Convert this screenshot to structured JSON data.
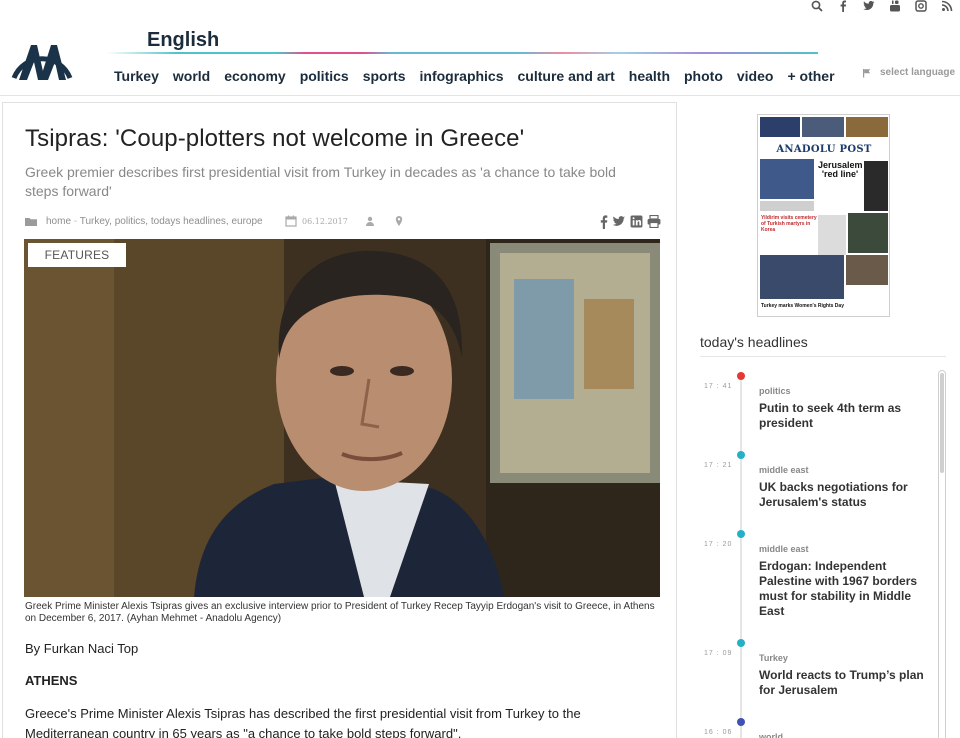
{
  "header": {
    "edition": "English",
    "nav": [
      "Turkey",
      "world",
      "economy",
      "politics",
      "sports",
      "infographics",
      "culture and art",
      "health",
      "photo",
      "video",
      "+ other"
    ],
    "select_language": "select language",
    "social_icons": [
      "search-icon",
      "facebook-icon",
      "twitter-icon",
      "youtube-icon",
      "instagram-icon",
      "rss-icon"
    ]
  },
  "article": {
    "title": "Tsipras: 'Coup-plotters not welcome in Greece'",
    "subtitle": "Greek premier describes first presidential visit from Turkey in decades as 'a chance to take bold steps forward'",
    "breadcrumb": {
      "home": "home",
      "sep": " - ",
      "tags": "Turkey, politics, todays headlines, europe"
    },
    "date": "06.12.2017",
    "badge": "FEATURES",
    "caption": "Greek Prime Minister Alexis Tsipras gives an exclusive interview prior to President of Turkey Recep Tayyip Erdogan's visit to Greece, in Athens on December 6, 2017. (Ayhan Mehmet - Anadolu Agency)",
    "byline": "By Furkan Naci Top",
    "dateline": "ATHENS",
    "body": "Greece's Prime Minister Alexis Tsipras has described the first presidential visit from Turkey to the Mediterranean country in 65 years as \"a chance to take bold steps forward\"."
  },
  "paper": {
    "masthead": "ANADOLU POST",
    "headline": "Jerusalem 'red line'",
    "red_story": "Yildirim visits cemetery of Turkish martyrs in Korea",
    "footer": "Turkey marks Women's Rights Day"
  },
  "headlines": {
    "title": "today's headlines",
    "items": [
      {
        "time": "17 : 41",
        "category": "politics",
        "headline": "Putin to seek 4th term as president",
        "color": "#e53935"
      },
      {
        "time": "17 : 21",
        "category": "middle east",
        "headline": "UK backs negotiations for Jerusalem's status",
        "color": "#26b0c8"
      },
      {
        "time": "17 : 20",
        "category": "middle east",
        "headline": "Erdogan: Independent Palestine with 1967 borders must for stability in Middle East",
        "color": "#26b0c8"
      },
      {
        "time": "17 : 09",
        "category": "Turkey",
        "headline": "World reacts to Trump’s plan for Jerusalem",
        "color": "#26b0c8"
      },
      {
        "time": "16 : 06",
        "category": "world",
        "headline": "",
        "color": "#3f51b5"
      }
    ]
  }
}
